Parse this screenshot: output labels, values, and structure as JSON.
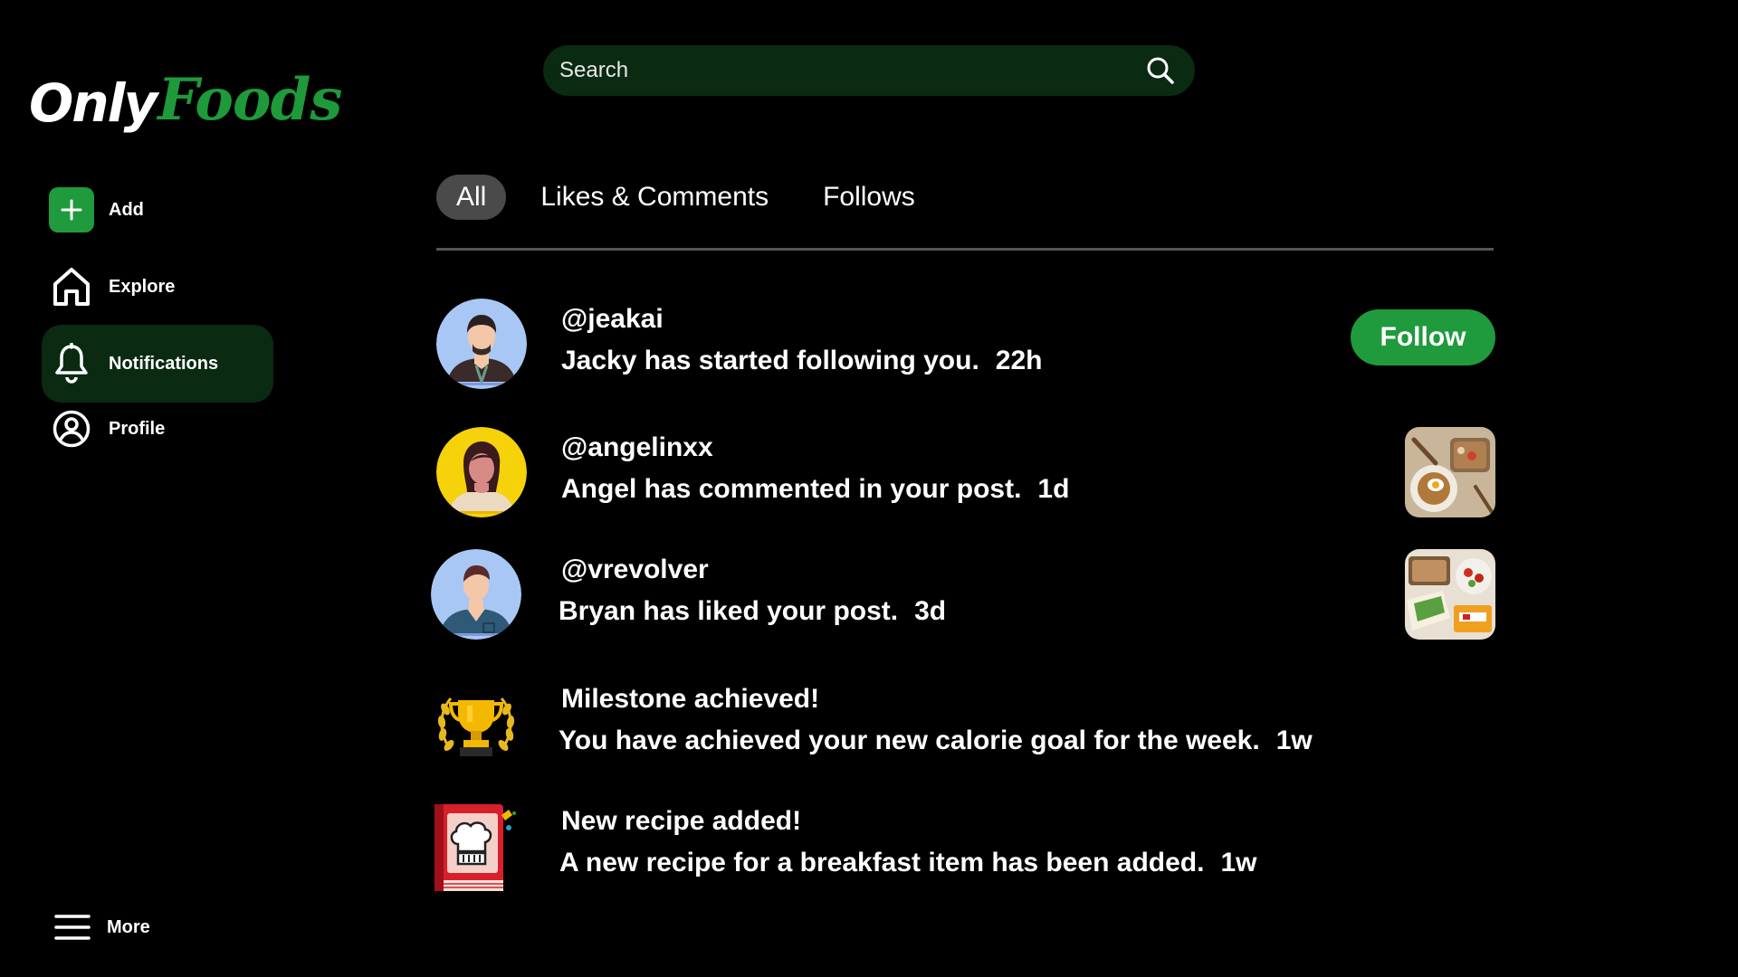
{
  "brand": {
    "logo_part1": "Only",
    "logo_part2": "Foods",
    "accent": "#1f9a3d"
  },
  "search": {
    "placeholder": "Search",
    "value": ""
  },
  "sidebar": {
    "items": [
      {
        "id": "add",
        "label": "Add",
        "icon": "plus-icon"
      },
      {
        "id": "explore",
        "label": "Explore",
        "icon": "home-icon"
      },
      {
        "id": "notifications",
        "label": "Notifications",
        "icon": "bell-icon",
        "active": true
      },
      {
        "id": "profile",
        "label": "Profile",
        "icon": "user-circle-icon"
      }
    ],
    "more": {
      "label": "More",
      "icon": "menu-icon"
    }
  },
  "tabs": [
    {
      "label": "All",
      "active": true
    },
    {
      "label": "Likes & Comments",
      "active": false
    },
    {
      "label": "Follows",
      "active": false
    }
  ],
  "notifications": [
    {
      "title": "@jeakai",
      "message": "Jacky has started following you.",
      "time": "22h",
      "action": "Follow",
      "icon": "avatar-jacky"
    },
    {
      "title": "@angelinxx",
      "message": "Angel has commented in your post.",
      "time": "1d",
      "thumbnail": "food-bowl-image",
      "icon": "avatar-angel"
    },
    {
      "title": "@vrevolver",
      "message": "Bryan has liked your post.",
      "time": "3d",
      "thumbnail": "food-wraps-image",
      "icon": "avatar-bryan"
    },
    {
      "title": "Milestone achieved!",
      "message": "You have achieved your new calorie goal for the week.",
      "time": "1w",
      "icon": "trophy-icon"
    },
    {
      "title": "New recipe added!",
      "message": "A new recipe for a breakfast item has been added.",
      "time": "1w",
      "icon": "recipe-book-icon"
    }
  ]
}
